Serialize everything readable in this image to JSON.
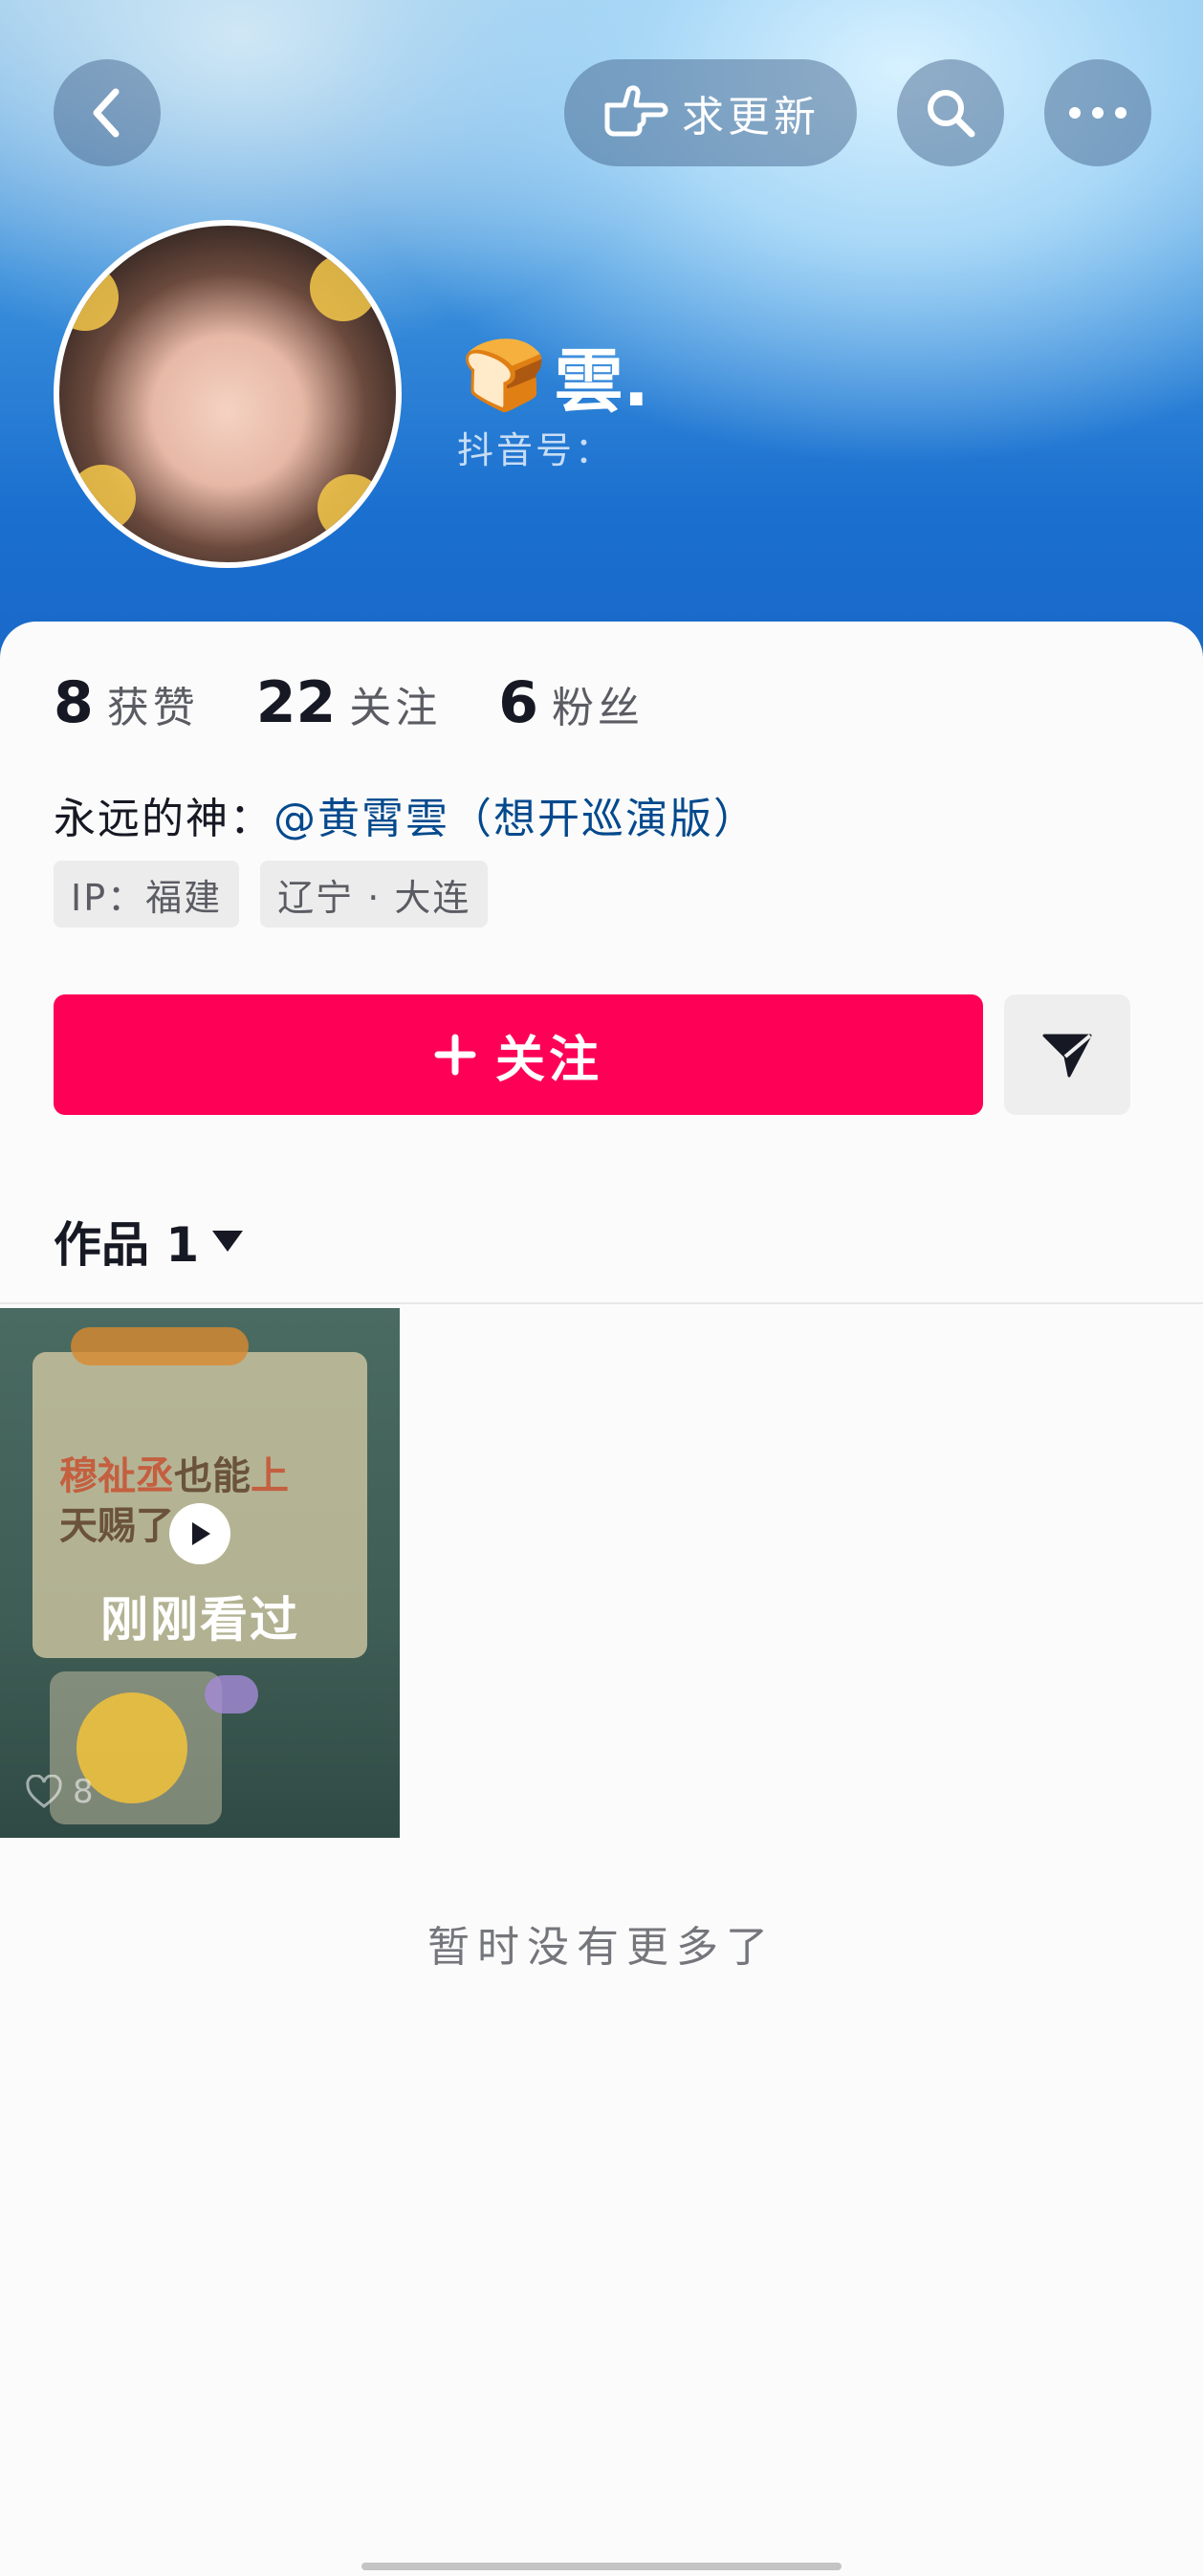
{
  "header": {
    "back_icon": "chevron-left-icon",
    "request_update_label": "求更新",
    "request_update_icon": "pointing-hand-icon",
    "search_icon": "search-icon",
    "more_icon": "more-dots-icon"
  },
  "profile": {
    "name_emoji": "🍞",
    "name": "雲.",
    "douyin_id_label": "抖音号："
  },
  "stats": [
    {
      "num": "8",
      "label": "获赞"
    },
    {
      "num": "22",
      "label": "关注"
    },
    {
      "num": "6",
      "label": "粉丝"
    }
  ],
  "bio": {
    "prefix": "永远的神：",
    "mention": "@黄霄雲（想开巡演版）"
  },
  "tags": [
    "IP：福建",
    "辽宁 · 大连"
  ],
  "actions": {
    "follow_label": "关注",
    "share_icon": "send-icon"
  },
  "works": {
    "tab_label": "作品 1",
    "items": [
      {
        "title_part1": "穆祉丞",
        "title_part2": "也能",
        "title_part3": "上",
        "title_line2": "天赐了",
        "overlay": "刚刚看过",
        "likes": "8"
      }
    ]
  },
  "footer": {
    "no_more": "暂时没有更多了"
  },
  "colors": {
    "follow_button": "#fe0056",
    "mention": "#04498d",
    "header_blue": "#1967c7"
  }
}
